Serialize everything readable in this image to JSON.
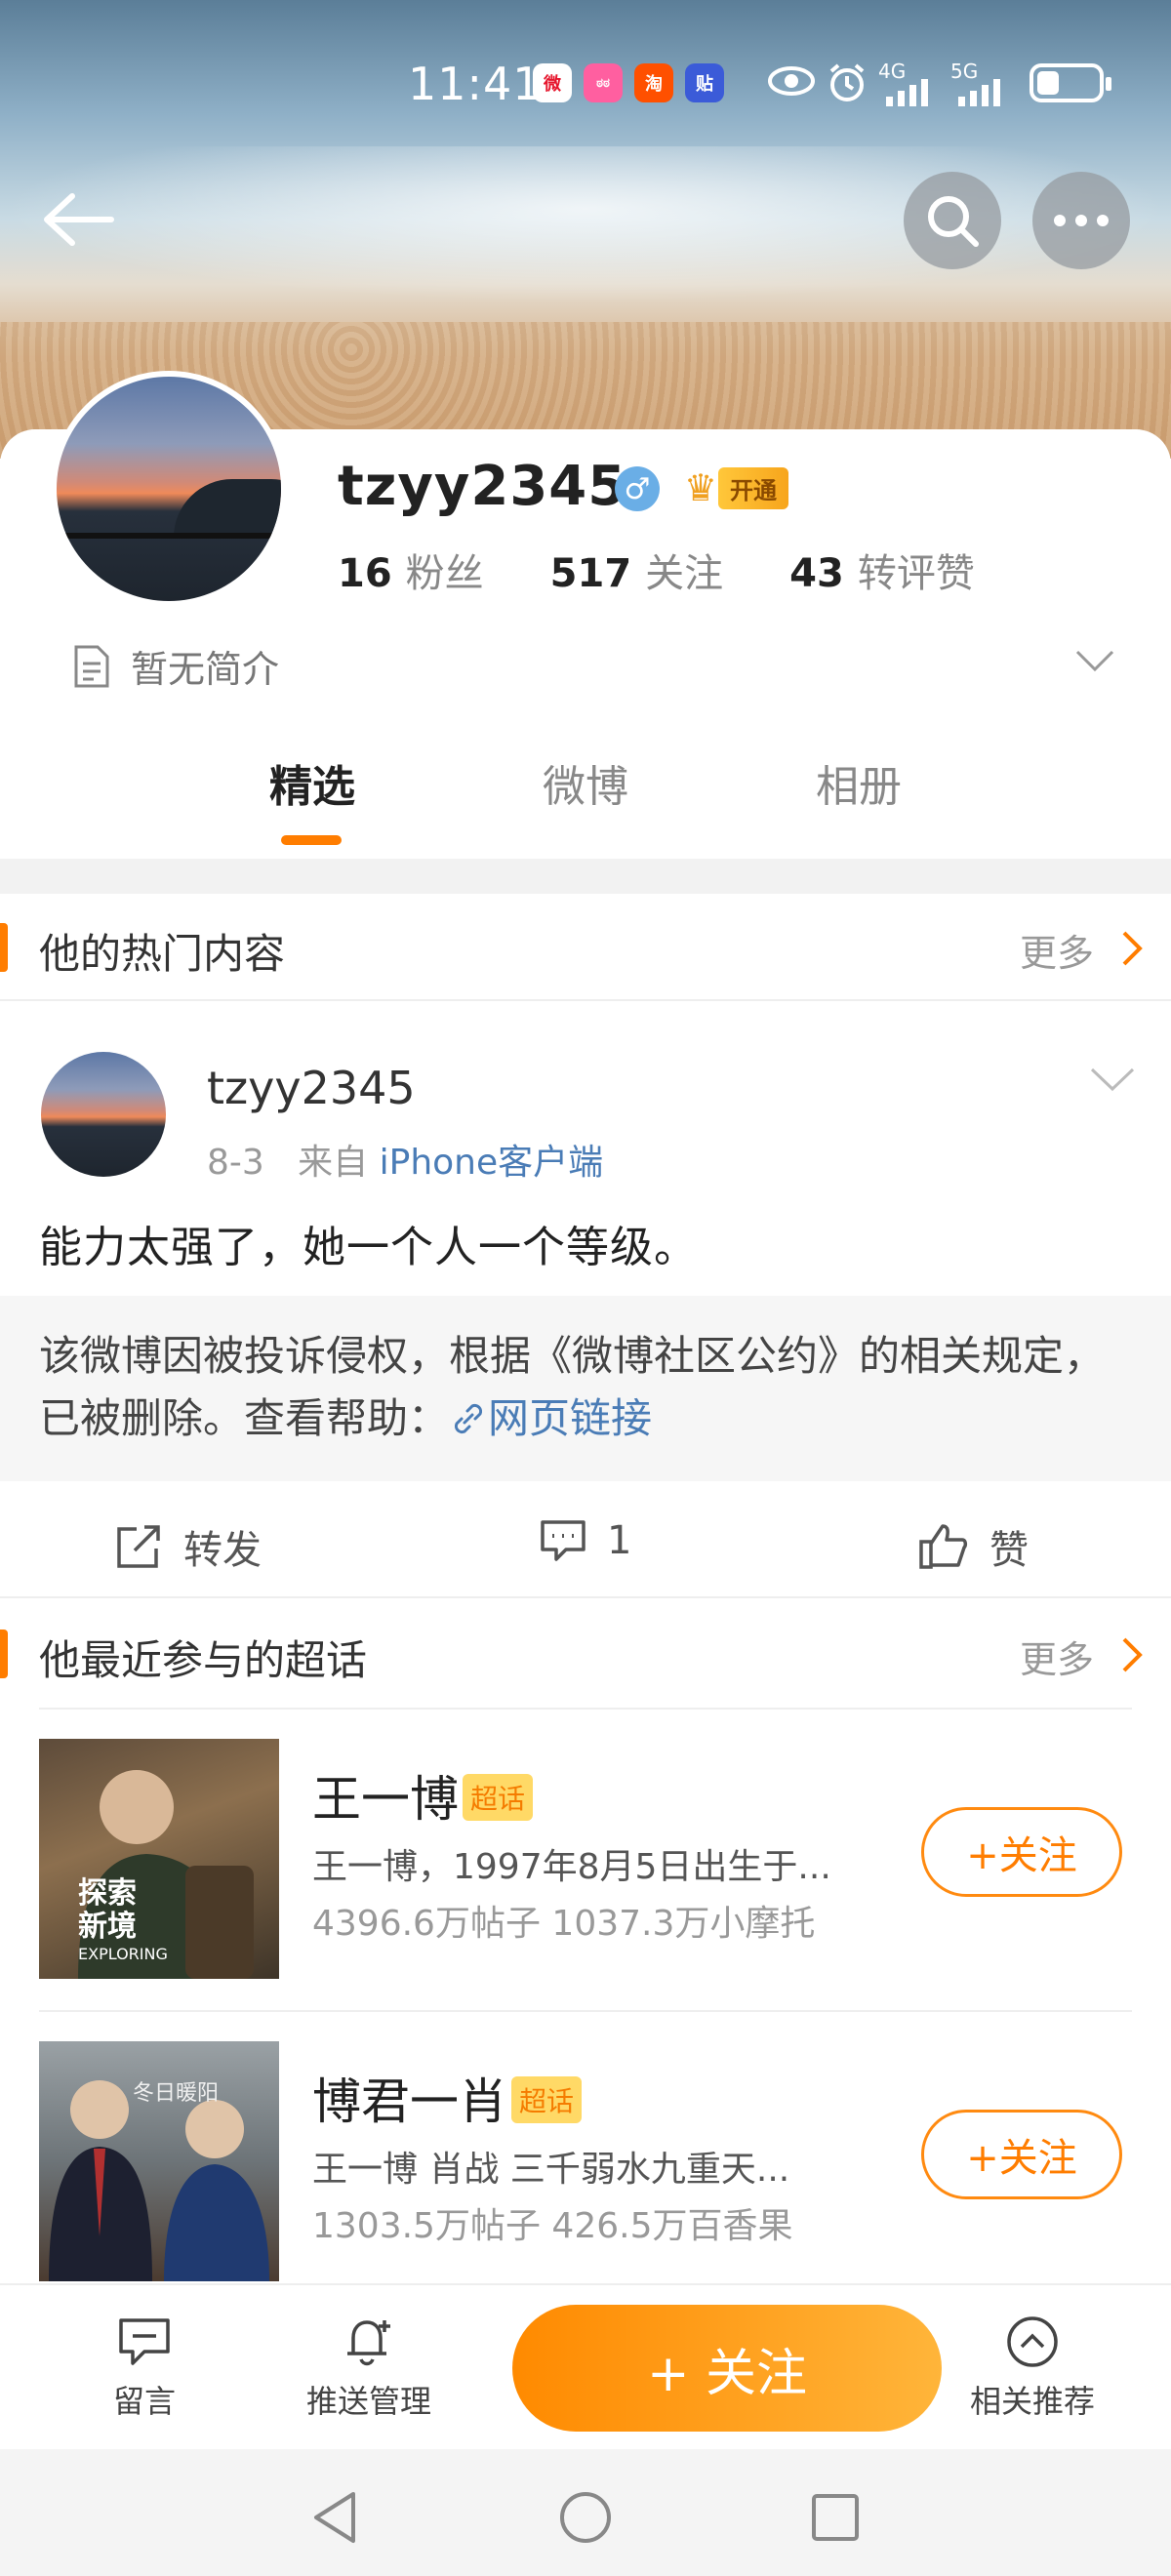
{
  "status_bar": {
    "time": "11:41",
    "apps": [
      {
        "name": "weibo-app-icon",
        "label": "微",
        "color": "#e6162d"
      },
      {
        "name": "app-icon-pink",
        "label": "ಠಠ",
        "color": "#ff5fa0"
      },
      {
        "name": "taobao-app-icon",
        "label": "淘",
        "color": "#ff5000"
      },
      {
        "name": "tieba-app-icon",
        "label": "贴",
        "color": "#3b5bd8"
      }
    ],
    "signal_1": "4G",
    "signal_2": "5G"
  },
  "profile": {
    "username": "tzyy2345",
    "gender_symbol": "♂",
    "vip_label": "开通",
    "stats": [
      {
        "value": "16",
        "label": "粉丝"
      },
      {
        "value": "517",
        "label": "关注"
      },
      {
        "value": "43",
        "label": "转评赞"
      }
    ],
    "bio": "暂无简介"
  },
  "tabs": [
    {
      "label": "精选",
      "active": true
    },
    {
      "label": "微博",
      "active": false
    },
    {
      "label": "相册",
      "active": false
    }
  ],
  "hot_section": {
    "title": "他的热门内容",
    "more": "更多"
  },
  "post": {
    "author": "tzyy2345",
    "date": "8-3",
    "from_prefix": "来自",
    "source": "iPhone客户端",
    "text": "能力太强了，她一个人一个等级。",
    "notice": "该微博因被投诉侵权，根据《微博社区公约》的相关规定，已被删除。查看帮助：",
    "notice_link": "网页链接",
    "repost_label": "转发",
    "comment_count": "1",
    "like_label": "赞"
  },
  "topics_section": {
    "title": "他最近参与的超话",
    "more": "更多"
  },
  "topics": [
    {
      "name": "王一博",
      "tag": "超话",
      "desc": "王一博，1997年8月5日出生于...",
      "stats": "4396.6万帖子 1037.3万小摩托",
      "follow": "+关注",
      "cover_text_1": "探索",
      "cover_text_2": "新境",
      "cover_text_3": "EXPLORING"
    },
    {
      "name": "博君一肖",
      "tag": "超话",
      "desc": "王一博 肖战  三千弱水九重天...",
      "stats": "1303.5万帖子 426.5万百香果",
      "follow": "+关注",
      "cover_text_1": "冬日暖阳"
    }
  ],
  "bottom_bar": {
    "message": "留言",
    "push": "推送管理",
    "follow": "+ 关注",
    "recommend": "相关推荐"
  },
  "colors": {
    "accent": "#ff7d00",
    "link": "#4a7cb6"
  }
}
